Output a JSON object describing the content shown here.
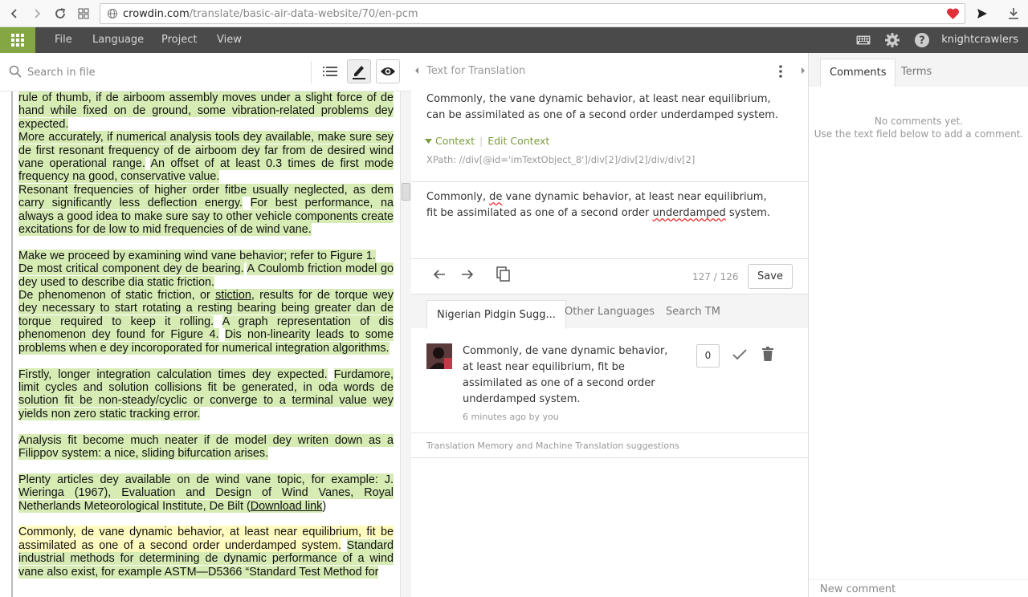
{
  "browser": {
    "url_host": "crowdin.com",
    "url_path": "/translate/basic-air-data-website/70/en-pcm"
  },
  "menu": {
    "items": [
      "File",
      "Language",
      "Project",
      "View"
    ],
    "username": "knightcrawlers"
  },
  "left": {
    "search_placeholder": "Search in file",
    "paragraphs": [
      {
        "segments": [
          {
            "text": "rule of thumb, if de airboom assembly moves under a slight force of de hand while fixed on de ground, some vibration-related problems dey expected.",
            "hl": "green"
          }
        ]
      },
      {
        "segments": [
          {
            "text": "More accurately, if numerical analysis tools dey available, make sure sey de first resonant frequency of de airboom dey far from de desired wind vane operational range.",
            "hl": "green"
          },
          {
            "text": " ",
            "hl": ""
          },
          {
            "text": "An offset of at least 0.3 times de first mode frequency na good, conservative value.",
            "hl": "green"
          }
        ]
      },
      {
        "segments": [
          {
            "text": "Resonant frequencies of higher order fitbe usually neglected, as dem carry significantly less deflection energy.",
            "hl": "green"
          },
          {
            "text": " ",
            "hl": ""
          },
          {
            "text": "For best performance, na always a good idea to make sure say to other vehicle components create excitations for de low to mid frequencies of de wind vane.",
            "hl": "green"
          }
        ],
        "gap": true
      },
      {
        "segments": [
          {
            "text": "Make we proceed by examining wind vane behavior; refer to Figure 1.",
            "hl": "green"
          }
        ]
      },
      {
        "segments": [
          {
            "text": "De most critical component dey de bearing.",
            "hl": "green"
          },
          {
            "text": " ",
            "hl": ""
          },
          {
            "text": "A Coulomb friction model go dey used to describe dia static friction.",
            "hl": "green"
          }
        ]
      },
      {
        "segments": [
          {
            "text": "De phenomenon of static friction, or ",
            "hl": "green"
          },
          {
            "text": "stiction",
            "hl": "green",
            "u": true
          },
          {
            "text": ", results for de torque wey dey necessary to start rotating a resting bearing being greater dan de torque required to keep it rolling.",
            "hl": "green"
          },
          {
            "text": " ",
            "hl": ""
          },
          {
            "text": "A graph representation of dis phenomenon dey found for Figure 4.",
            "hl": "green"
          },
          {
            "text": " ",
            "hl": ""
          },
          {
            "text": "Dis non-linearity leads to some problems when e dey incoroporated for numerical integration algorithms.",
            "hl": "green"
          }
        ],
        "gap": true
      },
      {
        "segments": [
          {
            "text": "Firstly, longer integration calculation times dey expected.",
            "hl": "green"
          },
          {
            "text": " ",
            "hl": ""
          },
          {
            "text": "Furdamore, limit cycles and solution collisions fit be generated, in oda words de solution fit be non-steady/cyclic or converge to a terminal value wey yields non zero static tracking error.",
            "hl": "green"
          }
        ],
        "gap": true
      },
      {
        "segments": [
          {
            "text": "Analysis fit become much neater if de model dey writen down as a Filippov system: a nice, sliding bifurcation arises.",
            "hl": "green"
          }
        ],
        "gap": true
      },
      {
        "segments": [
          {
            "text": "Plenty articles dey available on de wind vane topic, for example: J. Wieringa (1967), Evaluation and Design of Wind Vanes, Royal Netherlands Meteorological Institute, De Bilt (",
            "hl": "green"
          },
          {
            "text": "Download link",
            "hl": "green",
            "u": true
          },
          {
            "text": ")",
            "hl": ""
          }
        ],
        "gap": true
      },
      {
        "segments": [
          {
            "text": "Commonly, de vane dynamic behavior, at least near equilibrium, fit be assimilated as one of a second order underdamped system.",
            "hl": "yellow"
          },
          {
            "text": " ",
            "hl": ""
          },
          {
            "text": "Standard industrial methods for determining de dynamic performance of a wind vane also exist, for example ASTM—D5366 “Standard Test Method for",
            "hl": "green"
          }
        ]
      }
    ]
  },
  "middle": {
    "title": "Text for Translation",
    "source_text": "Commonly, the vane dynamic behavior, at least near equilibrium, can be assimilated as one of a second order underdamped system.",
    "context_label": "Context",
    "edit_context_label": "Edit Context",
    "xpath": "XPath: //div[@id='imTextObject_8']/div[2]/div[2]/div/div[2]",
    "translation": {
      "part1": "Commonly, ",
      "word1": "de",
      "part2": " vane dynamic behavior, at least near equilibrium, fit be assimilated as one of a second order ",
      "word2": "underdamped",
      "part3": " system."
    },
    "counter": "127 / 126",
    "save_label": "Save",
    "tabs": [
      "Nigerian Pidgin Sugg...",
      "Other Languages",
      "Search TM"
    ],
    "suggestion": {
      "text": "Commonly, de vane dynamic behavior, at least near equilibrium, fit be assimilated as one of a second order underdamped system.",
      "meta": "6 minutes ago by you",
      "votes": "0"
    },
    "tm_label": "Translation Memory and Machine Translation suggestions"
  },
  "right": {
    "tabs": [
      "Comments",
      "Terms"
    ],
    "no_comments_line1": "No comments yet.",
    "no_comments_line2": "Use the text field below to add a comment.",
    "new_comment_placeholder": "New comment"
  },
  "colors": {
    "accent_green": "#84a744",
    "highlight_green": "#d6ecb4",
    "highlight_yellow": "#fffbbe",
    "menubar": "#4a4a4a"
  }
}
